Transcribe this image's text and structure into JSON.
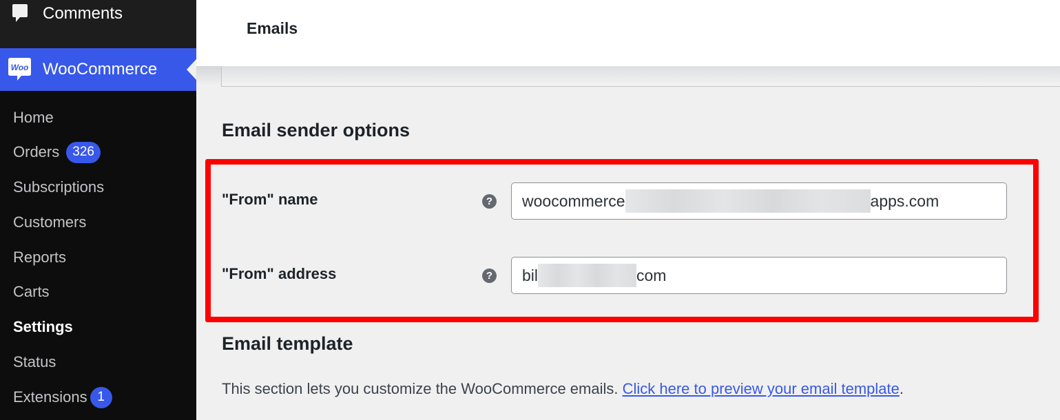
{
  "sidebar": {
    "comments_label": "Comments",
    "woocommerce_label": "WooCommerce",
    "woo_logo_text": "Woo",
    "items": [
      {
        "label": "Home"
      },
      {
        "label": "Orders",
        "badge": "326"
      },
      {
        "label": "Subscriptions"
      },
      {
        "label": "Customers"
      },
      {
        "label": "Reports"
      },
      {
        "label": "Carts"
      },
      {
        "label": "Settings",
        "current": true
      },
      {
        "label": "Status"
      },
      {
        "label": "Extensions",
        "badge": "1"
      }
    ]
  },
  "header": {
    "title": "Emails"
  },
  "sender_options": {
    "heading": "Email sender options",
    "from_name": {
      "label": "\"From\" name",
      "value_prefix": "woocommerce",
      "value_suffix": "apps.com",
      "help_icon": "?"
    },
    "from_address": {
      "label": "\"From\" address",
      "value_prefix": "bil",
      "value_suffix": "com",
      "help_icon": "?"
    }
  },
  "template": {
    "heading": "Email template",
    "description": "This section lets you customize the WooCommerce emails. ",
    "link_text": "Click here to preview your email template",
    "trailing": "."
  },
  "colors": {
    "accent": "#3858e9",
    "highlight": "#ff0000",
    "sidebar_bg": "#0d0d0d"
  }
}
